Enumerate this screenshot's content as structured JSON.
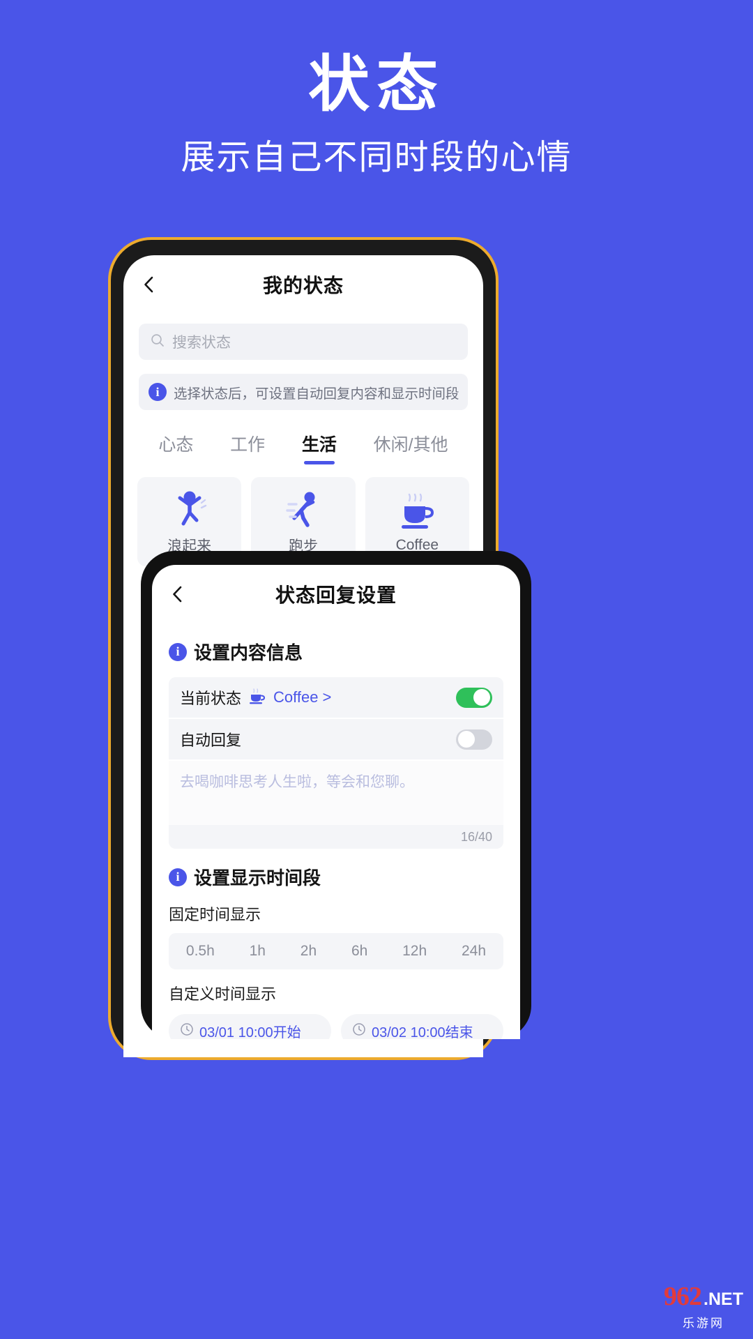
{
  "promo": {
    "title": "状态",
    "subtitle": "展示自己不同时段的心情"
  },
  "colors": {
    "background": "#4a55e8",
    "accent": "#4a55e8",
    "frame_border": "#edab2e",
    "toggle_on": "#2fc05a",
    "toggle_off": "#d3d5dc"
  },
  "status_screen": {
    "nav": {
      "back_icon": "chevron-left-icon",
      "title": "我的状态"
    },
    "search": {
      "icon": "search-icon",
      "placeholder": "搜索状态",
      "value": ""
    },
    "banner": {
      "icon": "info-icon",
      "badge": "i",
      "text": "选择状态后，可设置自动回复内容和显示时间段"
    },
    "tabs": [
      {
        "label": "心态",
        "active": false
      },
      {
        "label": "工作",
        "active": false
      },
      {
        "label": "生活",
        "active": true
      },
      {
        "label": "休闲/其他",
        "active": false
      }
    ],
    "cards": [
      {
        "label": "浪起来",
        "icon": "jumping-person-icon"
      },
      {
        "label": "跑步",
        "icon": "running-person-icon"
      },
      {
        "label": "Coffee",
        "icon": "coffee-cup-icon"
      }
    ]
  },
  "reply_screen": {
    "nav": {
      "back_icon": "chevron-left-icon",
      "title": "状态回复设置"
    },
    "content_section": {
      "badge": "i",
      "title": "设置内容信息",
      "current_status": {
        "label": "当前状态",
        "icon": "coffee-cup-icon",
        "value": "Coffee",
        "chevron": ">",
        "toggle": "on"
      },
      "auto_reply": {
        "label": "自动回复",
        "toggle": "off"
      },
      "reply_placeholder": "去喝咖啡思考人生啦，等会和您聊。",
      "counter": "16/40"
    },
    "time_section": {
      "badge": "i",
      "title": "设置显示时间段",
      "fixed_label": "固定时间显示",
      "fixed_options": [
        "0.5h",
        "1h",
        "2h",
        "6h",
        "12h",
        "24h"
      ],
      "custom_label": "自定义时间显示",
      "custom_range": [
        {
          "icon": "clock-icon",
          "text": "03/01 10:00开始"
        },
        {
          "icon": "clock-icon",
          "text": "03/02 10:00结束"
        }
      ]
    }
  },
  "watermark": {
    "brand": "962",
    "domain": ".NET",
    "sub": "乐游网"
  }
}
